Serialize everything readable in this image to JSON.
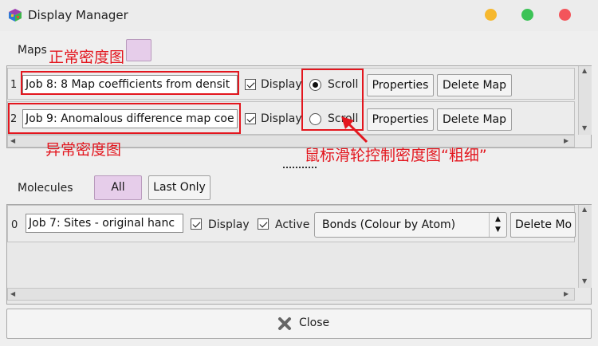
{
  "window": {
    "title": "Display Manager"
  },
  "maps": {
    "label": "Maps",
    "rows": [
      {
        "index": "1",
        "name": "Job 8: 8 Map coefficients from densit",
        "display_label": "Display",
        "scroll_label": "Scroll",
        "scroll_selected": true,
        "properties_label": "Properties",
        "delete_label": "Delete Map"
      },
      {
        "index": "2",
        "name": "Job 9: Anomalous difference map coe",
        "display_label": "Display",
        "scroll_label": "Scroll",
        "scroll_selected": false,
        "properties_label": "Properties",
        "delete_label": "Delete Map"
      }
    ]
  },
  "molecules": {
    "label": "Molecules",
    "all_label": "All",
    "last_only_label": "Last Only",
    "rows": [
      {
        "index": "0",
        "name": "Job 7: Sites - original hanc",
        "display_label": "Display",
        "active_label": "Active",
        "bonds_option": "Bonds (Colour by Atom)",
        "delete_label": "Delete Mo"
      }
    ]
  },
  "close_label": "Close",
  "annotations": {
    "normal_map": "正常密度图",
    "anomalous_map": "异常密度图",
    "scroll_note": "鼠标滑轮控制密度图“粗细”",
    "color": "#e3161e"
  },
  "colors": {
    "selected_button": "#e6cdea"
  }
}
